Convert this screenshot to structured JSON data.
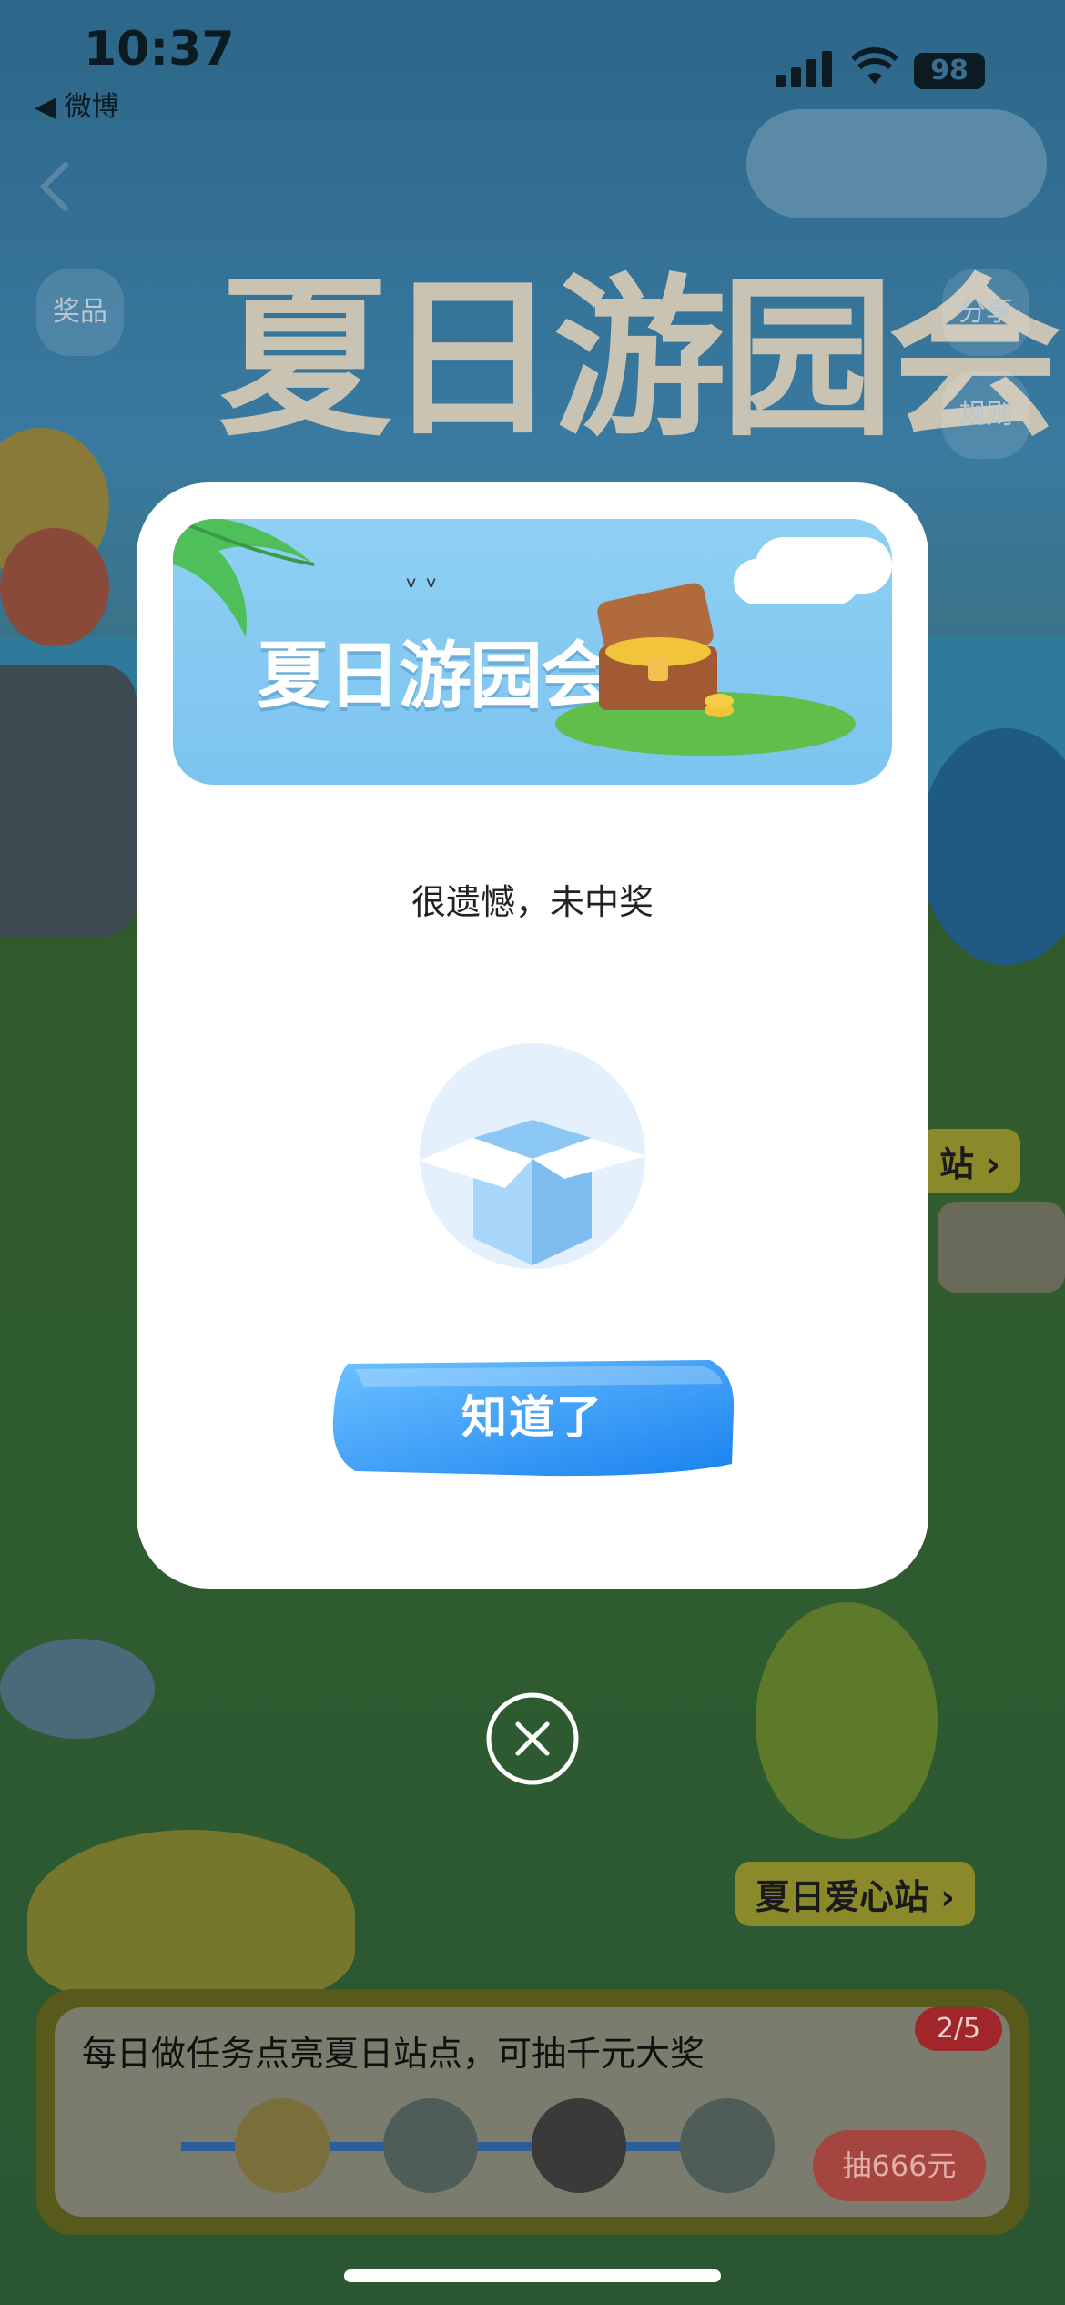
{
  "status_bar": {
    "time": "10:37",
    "back_app": "◀ 微博",
    "battery": "98"
  },
  "background": {
    "title": "夏日游园会",
    "left_pill": "奖品",
    "right_pills": [
      "分享",
      "规则"
    ],
    "sign_right": "站 ›",
    "sign_love": "夏日爱心站 ›",
    "task_text": "每日做任务点亮夏日站点，可抽千元大奖",
    "task_count": "2/5",
    "draw_button": "抽666元"
  },
  "modal": {
    "banner_title": "夏日游园会",
    "result_text": "很遗憾，未中奖",
    "confirm_label": "知道了",
    "colors": {
      "banner_bg": "#8fd0f4",
      "button_blue": "#2f8fee",
      "box_blue": "#a9d6fb"
    }
  },
  "icons": {
    "close": "close-icon",
    "empty_box": "empty-box-icon",
    "back": "chevron-left-icon"
  }
}
